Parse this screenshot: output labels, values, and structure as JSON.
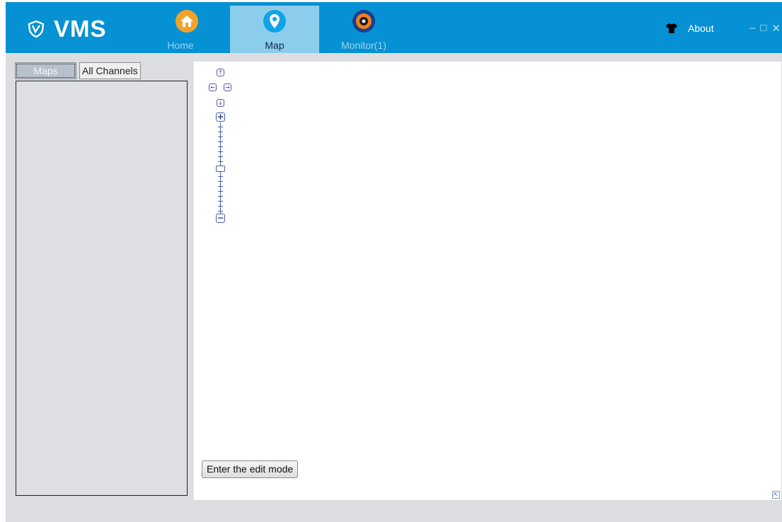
{
  "header": {
    "app_name": "VMS",
    "nav": [
      {
        "label": "Home",
        "icon": "home-icon"
      },
      {
        "label": "Map",
        "icon": "map-pin-icon"
      },
      {
        "label": "Monitor(1)",
        "icon": "monitor-camera-icon"
      }
    ],
    "about_label": "About",
    "window_controls": {
      "minimize": "–",
      "maximize": "□",
      "close": "✕"
    },
    "colors": {
      "bar": "#0591d3",
      "active_tab": "#8ccdec",
      "home_icon": "#f3a327"
    }
  },
  "left_panel": {
    "tabs": [
      {
        "label": "Maps",
        "selected": true
      },
      {
        "label": "All Channels",
        "selected": false
      }
    ]
  },
  "map": {
    "pan_controls": {
      "up": "↑",
      "left": "←",
      "right": "→",
      "down": "↓"
    },
    "zoom_in": "+",
    "zoom_out": "−",
    "edit_button_label": "Enter the edit mode",
    "overview_toggle": "⇱"
  }
}
